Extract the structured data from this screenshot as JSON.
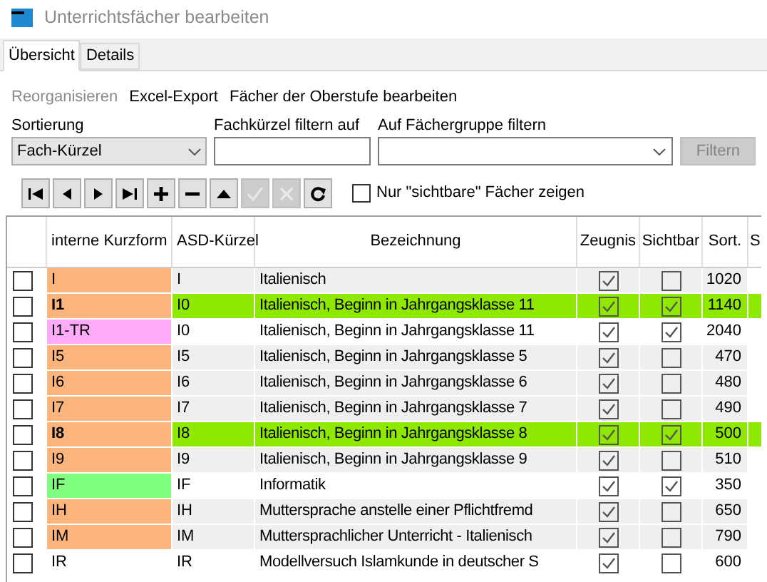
{
  "window": {
    "title": "Unterrichtsfächer bearbeiten"
  },
  "tabs": [
    {
      "label": "Übersicht",
      "selected": true
    },
    {
      "label": "Details",
      "selected": false
    }
  ],
  "menu": [
    {
      "label": "Reorganisieren",
      "disabled": true
    },
    {
      "label": "Excel-Export",
      "disabled": false
    },
    {
      "label": "Fächer der Oberstufe bearbeiten",
      "disabled": false
    }
  ],
  "filters": {
    "sort_label": "Sortierung",
    "sort_value": "Fach-Kürzel",
    "abbr_label": "Fachkürzel filtern auf",
    "group_label": "Auf Fächergruppe filtern",
    "filter_button": {
      "label": "Filtern",
      "disabled": true
    }
  },
  "toolbar": [
    {
      "kind": "first",
      "disabled": false
    },
    {
      "kind": "prev",
      "disabled": false
    },
    {
      "kind": "next",
      "disabled": false
    },
    {
      "kind": "last",
      "disabled": false
    },
    {
      "kind": "add",
      "disabled": false
    },
    {
      "kind": "remove",
      "disabled": false
    },
    {
      "kind": "up",
      "disabled": false
    },
    {
      "kind": "confirm",
      "disabled": true
    },
    {
      "kind": "cancel",
      "disabled": true
    },
    {
      "kind": "refresh",
      "disabled": false
    }
  ],
  "visible_only": {
    "label": "Nur \"sichtbare\" Fächer zeigen",
    "checked": false
  },
  "table": {
    "columns": [
      "interne Kurzform",
      "ASD-Kürzel",
      "Bezeichnung",
      "Zeugnis",
      "Sichtbar",
      "Sort.",
      "S"
    ],
    "rows": [
      {
        "checked": false,
        "kurzform": "I",
        "color": "#fbb57c",
        "asd": "I",
        "bezeichnung": "Italienisch",
        "zeugnis": true,
        "sichtbar": false,
        "sort": "1020",
        "highlighted": false,
        "shaded": true
      },
      {
        "checked": false,
        "kurzform": "I1",
        "color": "#fbb57c",
        "asd": "I0",
        "bezeichnung": "Italienisch, Beginn in Jahrgangsklasse 11",
        "zeugnis": true,
        "sichtbar": true,
        "sort": "1140",
        "highlighted": true
      },
      {
        "checked": false,
        "kurzform": "I1-TR",
        "color": "#fdabf9",
        "asd": "I0",
        "bezeichnung": "Italienisch, Beginn in Jahrgangsklasse 11",
        "zeugnis": true,
        "sichtbar": true,
        "sort": "2040",
        "highlighted": false,
        "shaded": false
      },
      {
        "checked": false,
        "kurzform": "I5",
        "color": "#fbb57c",
        "asd": "I5",
        "bezeichnung": "Italienisch, Beginn in Jahrgangsklasse 5",
        "zeugnis": true,
        "sichtbar": false,
        "sort": "470",
        "highlighted": false,
        "shaded": true
      },
      {
        "checked": false,
        "kurzform": "I6",
        "color": "#fbb57c",
        "asd": "I6",
        "bezeichnung": "Italienisch, Beginn in Jahrgangsklasse 6",
        "zeugnis": true,
        "sichtbar": false,
        "sort": "480",
        "highlighted": false,
        "shaded": true
      },
      {
        "checked": false,
        "kurzform": "I7",
        "color": "#fbb57c",
        "asd": "I7",
        "bezeichnung": "Italienisch, Beginn in Jahrgangsklasse 7",
        "zeugnis": true,
        "sichtbar": false,
        "sort": "490",
        "highlighted": false,
        "shaded": true
      },
      {
        "checked": false,
        "kurzform": "I8",
        "color": "#fbb57c",
        "asd": "I8",
        "bezeichnung": "Italienisch, Beginn in Jahrgangsklasse 8",
        "zeugnis": true,
        "sichtbar": true,
        "sort": "500",
        "highlighted": true
      },
      {
        "checked": false,
        "kurzform": "I9",
        "color": "#fbb57c",
        "asd": "I9",
        "bezeichnung": "Italienisch, Beginn in Jahrgangsklasse 9",
        "zeugnis": true,
        "sichtbar": false,
        "sort": "510",
        "highlighted": false,
        "shaded": true
      },
      {
        "checked": false,
        "kurzform": "IF",
        "color": "#80ff80",
        "asd": "IF",
        "bezeichnung": "Informatik",
        "zeugnis": true,
        "sichtbar": true,
        "sort": "350",
        "highlighted": false,
        "shaded": false
      },
      {
        "checked": false,
        "kurzform": "IH",
        "color": "#fbb57c",
        "asd": "IH",
        "bezeichnung": "Muttersprache anstelle einer Pflichtfremd",
        "zeugnis": true,
        "sichtbar": false,
        "sort": "650",
        "highlighted": false,
        "shaded": true
      },
      {
        "checked": false,
        "kurzform": "IM",
        "color": "#fbb57c",
        "asd": "IM",
        "bezeichnung": "Muttersprachlicher Unterricht - Italienisch",
        "zeugnis": true,
        "sichtbar": false,
        "sort": "790",
        "highlighted": false,
        "shaded": true
      },
      {
        "checked": false,
        "kurzform": "IR",
        "color": "#ffffff",
        "asd": "IR",
        "bezeichnung": "Modellversuch Islamkunde in deutscher S",
        "zeugnis": true,
        "sichtbar": false,
        "sort": "600",
        "highlighted": false,
        "shaded": false
      }
    ]
  }
}
